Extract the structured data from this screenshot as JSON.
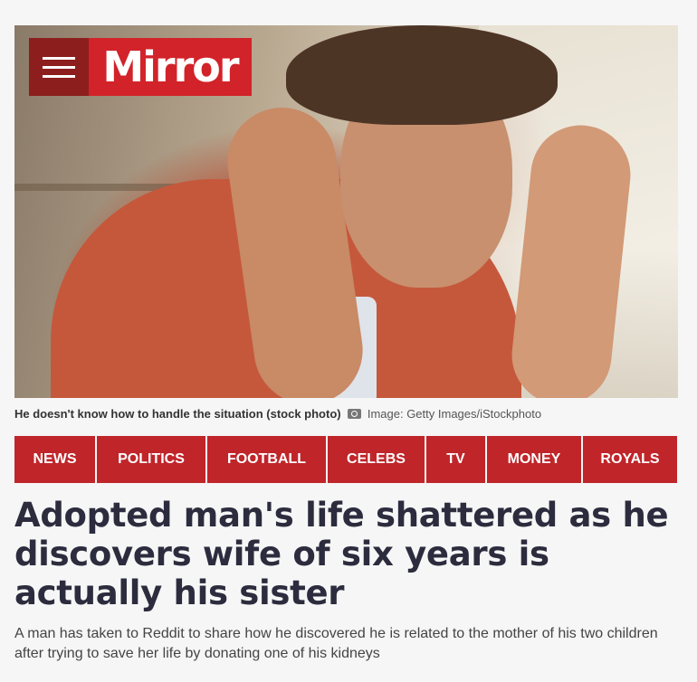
{
  "brand": {
    "name": "Mirror",
    "primary_color": "#d2232a",
    "menu_color": "#8d1e1e"
  },
  "hero": {
    "caption": "He doesn't know how to handle the situation (stock photo)",
    "credit": "Image: Getty Images/iStockphoto"
  },
  "nav": {
    "items": [
      {
        "label": "NEWS"
      },
      {
        "label": "POLITICS"
      },
      {
        "label": "FOOTBALL"
      },
      {
        "label": "CELEBS"
      },
      {
        "label": "TV"
      },
      {
        "label": "MONEY"
      },
      {
        "label": "ROYALS"
      }
    ],
    "color": "#c0252a"
  },
  "article": {
    "headline": "Adopted man's life shattered as he discovers wife of six years is actually his sister",
    "standfirst": "A man has taken to Reddit to share how he discovered he is related to the mother of his two children after trying to save her life by donating one of his kidneys"
  }
}
